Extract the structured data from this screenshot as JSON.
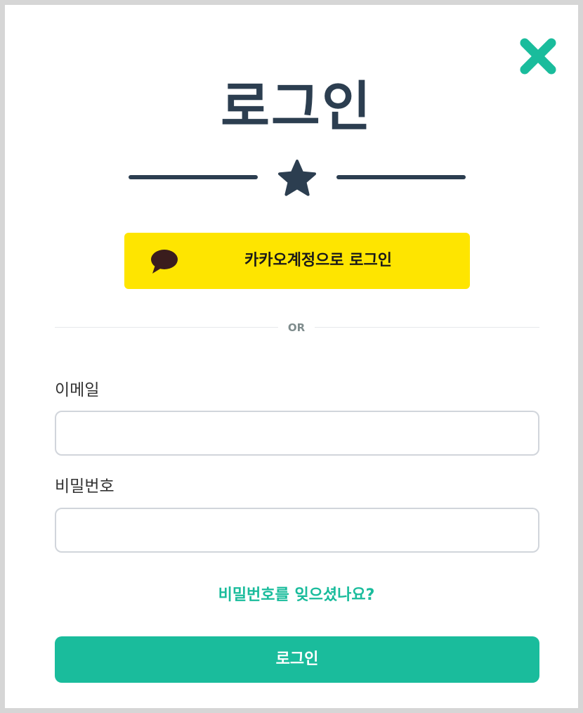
{
  "modal": {
    "title": "로그인",
    "close_icon": "close-x-icon",
    "divider_icon": "star-icon"
  },
  "kakao": {
    "label": "카카오계정으로 로그인",
    "icon": "speech-bubble-icon",
    "background": "#fee500"
  },
  "separator": {
    "text": "OR"
  },
  "form": {
    "email_label": "이메일",
    "email_value": "",
    "password_label": "비밀번호",
    "password_value": "",
    "forgot_password_label": "비밀번호를 잊으셨나요?",
    "submit_label": "로그인"
  },
  "colors": {
    "accent": "#1abc9c",
    "title": "#2c3e50",
    "kakao_yellow": "#fee500"
  }
}
